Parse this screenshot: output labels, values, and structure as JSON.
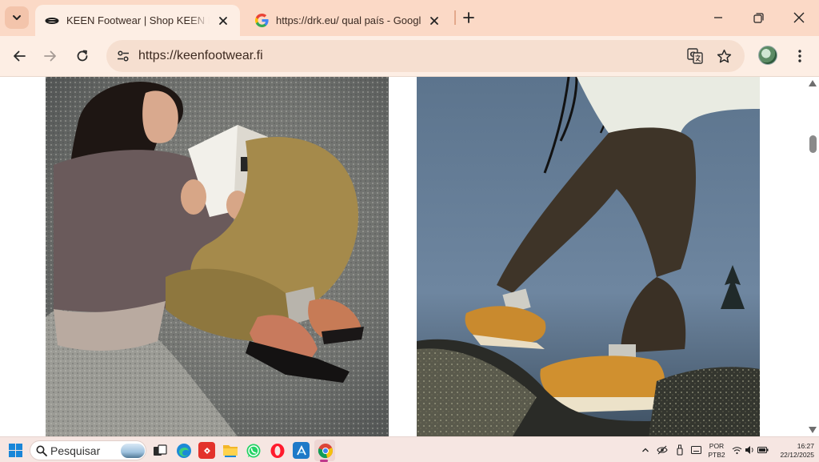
{
  "browser": {
    "tabs": [
      {
        "title": "KEEN Footwear | Shop KEEN Footwear",
        "favicon": "keen-logo-icon",
        "active": true
      },
      {
        "title": "https://drk.eu/ qual país - Google",
        "favicon": "google-g-icon",
        "active": false
      }
    ],
    "address_bar": {
      "url": "https://keenfootwear.fi"
    },
    "colors": {
      "frame": "#fbd9c6",
      "toolbar": "#fdeee4",
      "omnibox": "#f6dfd0"
    }
  },
  "page": {
    "images": [
      {
        "subject": "woman reading a book lying on a granite boulder, wearing orange KEEN shoes"
      },
      {
        "subject": "person in brown trousers stepping on rocks in orange KEEN hiking shoes at dusk"
      }
    ]
  },
  "taskbar": {
    "search_placeholder": "Pesquisar",
    "language_line1": "POR",
    "language_line2": "PTB2",
    "time": "16:27",
    "date": "22/12/2025",
    "apps": [
      "windows-start-icon",
      "search-icon",
      "task-view-icon",
      "edge-icon",
      "anydesk-icon",
      "file-explorer-icon",
      "whatsapp-icon",
      "opera-icon",
      "store-app-icon",
      "chrome-icon"
    ]
  }
}
